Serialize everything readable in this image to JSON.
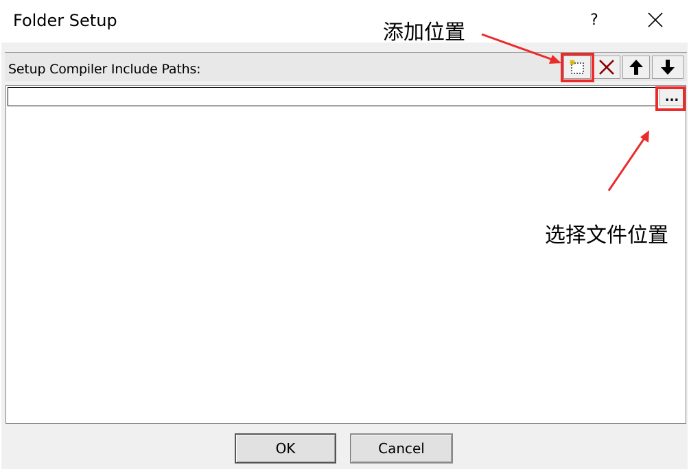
{
  "window": {
    "title": "Folder Setup",
    "help_label": "?",
    "close_icon": "close-icon"
  },
  "toolbar": {
    "label": "Setup Compiler Include Paths:",
    "buttons": [
      {
        "name": "new-folder",
        "icon": "new-folder-icon"
      },
      {
        "name": "delete",
        "icon": "delete-x-icon"
      },
      {
        "name": "move-up",
        "icon": "arrow-up-icon"
      },
      {
        "name": "move-down",
        "icon": "arrow-down-icon"
      }
    ]
  },
  "path_list": {
    "rows": [
      {
        "value": "",
        "browse_label": "..."
      }
    ]
  },
  "buttons": {
    "ok_label": "OK",
    "cancel_label": "Cancel"
  },
  "annotations": {
    "add_location": "添加位置",
    "choose_file_location": "选择文件位置",
    "highlight_color": "#ec2a2a"
  }
}
